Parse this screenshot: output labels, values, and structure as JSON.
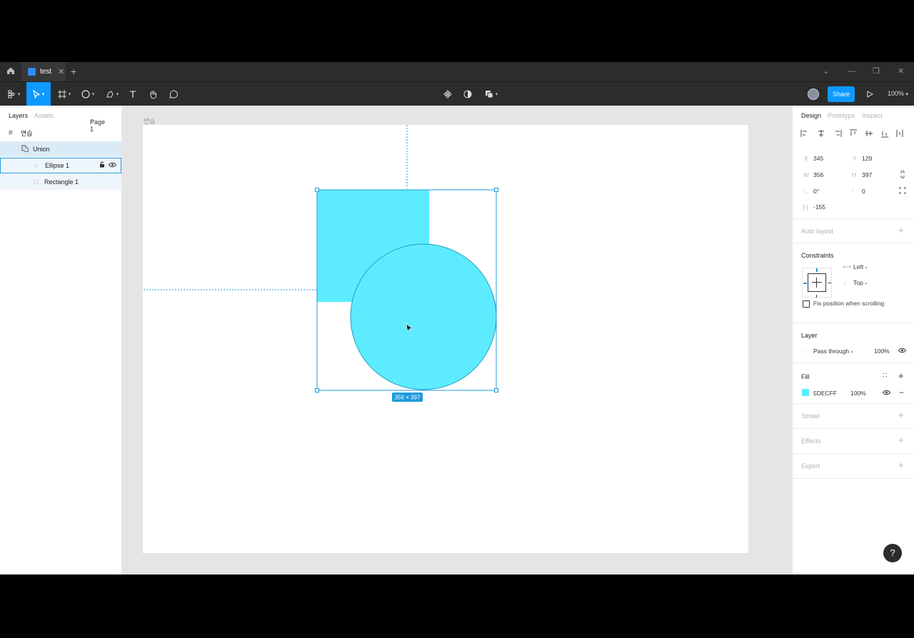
{
  "tab": {
    "name": "test"
  },
  "toolbar": {
    "share_label": "Share",
    "zoom": "100%"
  },
  "left_panel": {
    "tabs": [
      "Layers",
      "Assets"
    ],
    "page": "Page 1",
    "layers": [
      {
        "label": "연습",
        "icon": "frame-icon"
      },
      {
        "label": "Union",
        "icon": "union-icon"
      },
      {
        "label": "Ellipse 1",
        "icon": "ellipse-icon"
      },
      {
        "label": "Rectangle 1",
        "icon": "rectangle-icon"
      }
    ]
  },
  "canvas": {
    "frame_label": "연습",
    "shape_fill": "#5DECFF",
    "selection_color": "#1e9bdf",
    "size_badge": "356 × 397"
  },
  "right_panel": {
    "tabs": [
      "Design",
      "Prototype",
      "Inspect"
    ],
    "x_label": "X",
    "x": "345",
    "y_label": "Y",
    "y": "129",
    "w_label": "W",
    "w": "356",
    "h_label": "H",
    "h": "397",
    "rotation": "0°",
    "radius": "0",
    "spacing": "-155",
    "auto_layout": "Auto layout",
    "constraints": {
      "title": "Constraints",
      "horizontal": "Left",
      "vertical": "Top",
      "fix_label": "Fix position when scrolling"
    },
    "layer": {
      "title": "Layer",
      "blend": "Pass through",
      "opacity": "100%"
    },
    "fill": {
      "title": "Fill",
      "hex": "5DECFF",
      "opacity": "100%",
      "swatch": "#5DECFF"
    },
    "stroke": "Stroke",
    "effects": "Effects",
    "export": "Export"
  },
  "help_label": "?"
}
